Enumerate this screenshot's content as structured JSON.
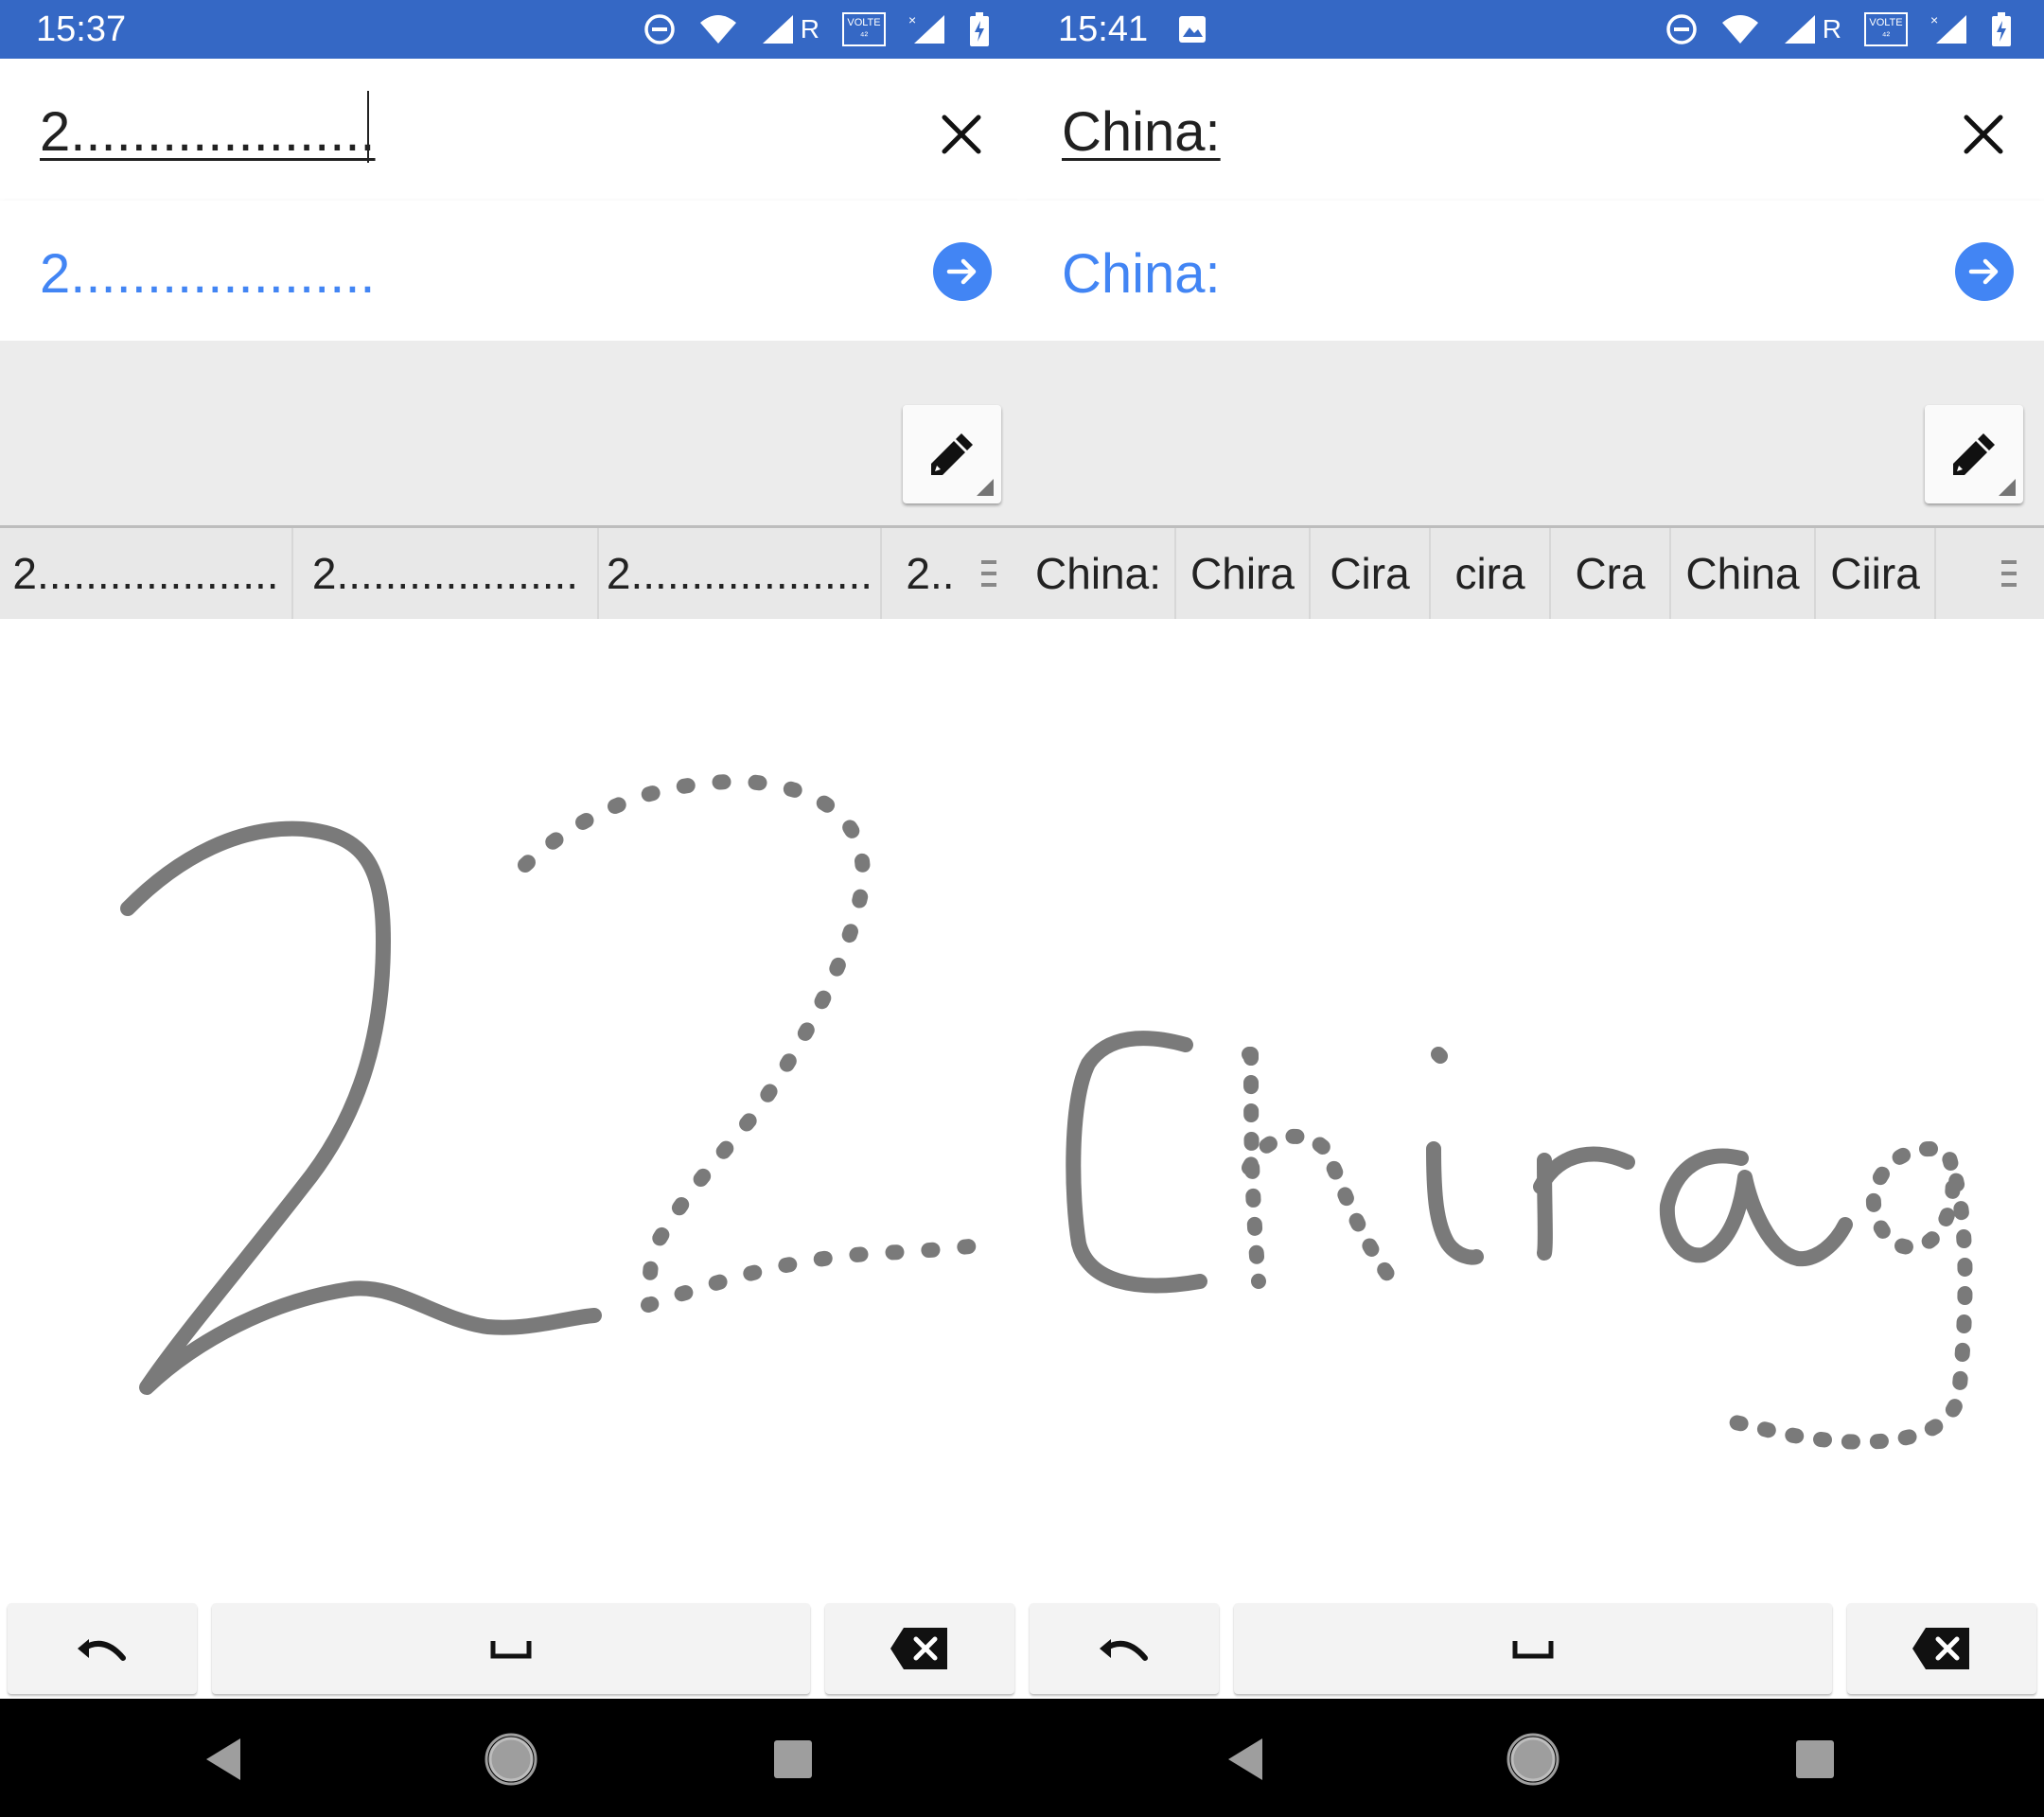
{
  "left": {
    "status": {
      "time": "15:37",
      "r_label": "R",
      "volte_label": "VOLTE"
    },
    "query": "2....................",
    "suggestion": "2....................",
    "candidates": [
      "2....................",
      "2....................",
      "2....................",
      "2.."
    ]
  },
  "right": {
    "status": {
      "time": "15:41",
      "r_label": "R",
      "volte_label": "VOLTE"
    },
    "query": "China:",
    "suggestion": "China:",
    "candidates": [
      "China:",
      "Chira",
      "Cira",
      "cira",
      "Cra",
      "China",
      "Ciira"
    ]
  },
  "icons": {
    "dnd": "do-not-disturb-icon",
    "wifi": "wifi-icon",
    "signal": "signal-icon",
    "battery": "battery-charging-icon",
    "gallery": "image-icon",
    "clear": "close-icon",
    "go": "arrow-right-icon",
    "pen": "pen-icon",
    "more": "more-candidates-icon",
    "undo": "undo-icon",
    "space": "space-icon",
    "backspace": "backspace-icon",
    "back": "back-icon",
    "home": "home-icon",
    "recents": "recents-icon"
  },
  "colors": {
    "status_bar": "#3568c5",
    "accent": "#4285f4",
    "ink": "#7a7a7a"
  }
}
